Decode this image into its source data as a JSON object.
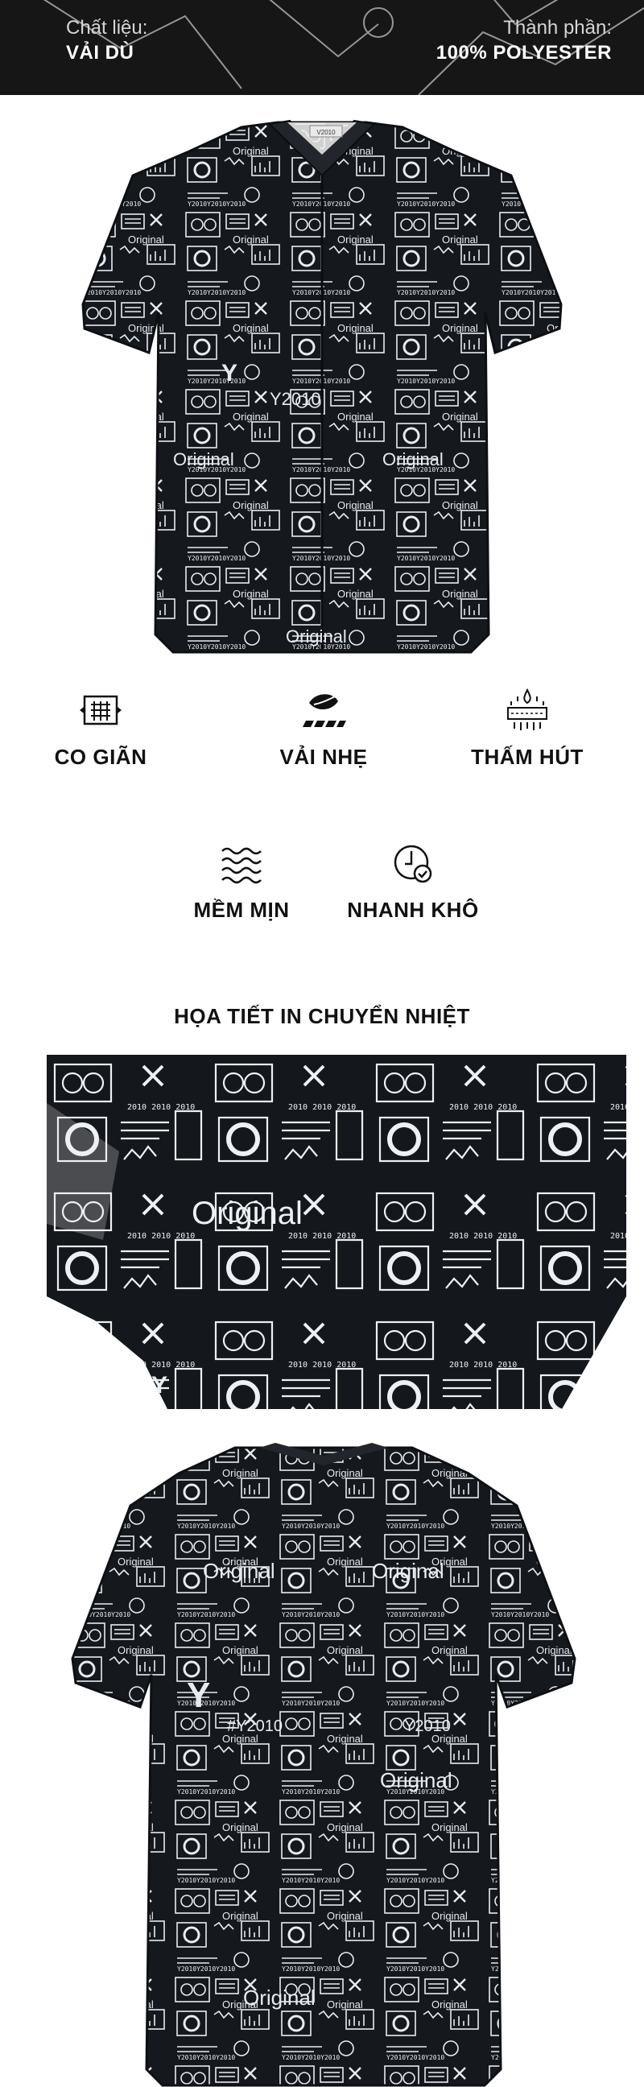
{
  "banner": {
    "material_label": "Chất liệu:",
    "material_value": "VẢI DÙ",
    "composition_label": "Thành phần:",
    "composition_value": "100% POLYESTER"
  },
  "shirt_print": {
    "word": "Original",
    "logo": "Y",
    "year": "Y2010",
    "tag": "#Y2010",
    "brand_label": "V2010"
  },
  "features": [
    {
      "label": "CO GIÃN",
      "icon": "stretch-fabric-icon"
    },
    {
      "label": "VẢI NHẸ",
      "icon": "lightweight-feather-icon"
    },
    {
      "label": "THẤM HÚT",
      "icon": "absorbent-drops-icon"
    },
    {
      "label": "MỀM MỊN",
      "icon": "soft-waves-icon"
    },
    {
      "label": "NHANH KHÔ",
      "icon": "quick-dry-clock-icon"
    }
  ],
  "section_title": "HỌA TIẾT IN CHUYỂN NHIỆT",
  "colors": {
    "banner_bg": "#161616",
    "fabric": "#15181d",
    "print": "#e8ecf0",
    "text": "#111111"
  }
}
